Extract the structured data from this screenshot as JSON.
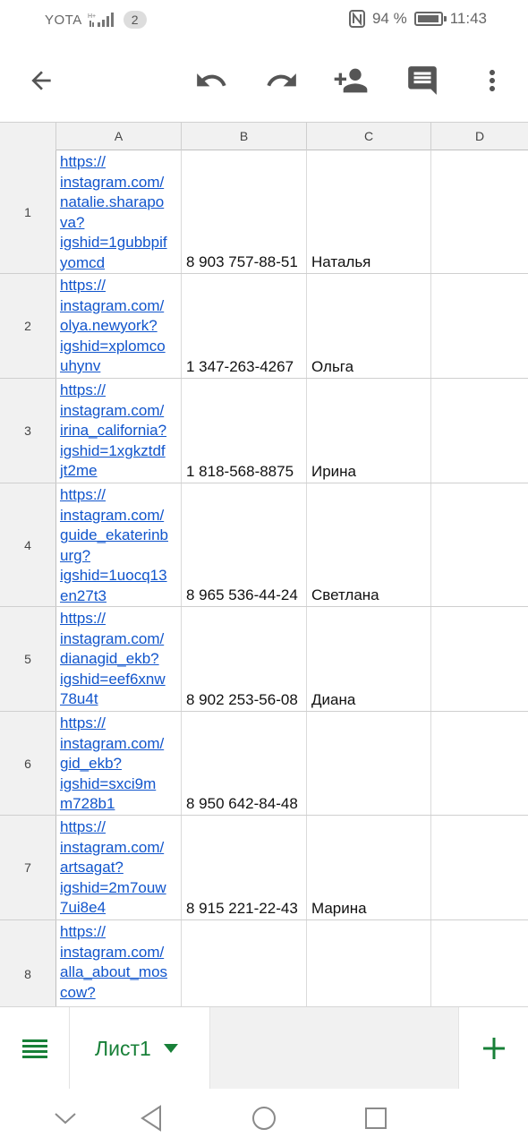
{
  "status_bar": {
    "carrier": "YOTA",
    "notifications_count": "2",
    "battery_text": "94 %",
    "battery_level": 0.94,
    "time": "11:43"
  },
  "toolbar": {
    "icons": [
      "back-arrow-icon",
      "undo-icon",
      "redo-icon",
      "add-person-icon",
      "comment-icon",
      "more-vert-icon"
    ]
  },
  "grid": {
    "columns": [
      "A",
      "B",
      "C",
      "D"
    ],
    "rows": [
      {
        "num": "1",
        "a_lines": [
          "https://",
          "instagram.com/",
          "natalie.sharapo",
          "va?",
          "igshid=1gubbpif",
          "yomcd"
        ],
        "b": "8 903 757-88-51",
        "c": "Наталья"
      },
      {
        "num": "2",
        "a_lines": [
          "https://",
          "instagram.com/",
          "olya.newyork?",
          "igshid=xplomco",
          "uhynv"
        ],
        "b": "1 347-263-4267",
        "c": "Ольга"
      },
      {
        "num": "3",
        "a_lines": [
          "https://",
          "instagram.com/",
          "irina_california?",
          "igshid=1xgkztdf",
          "jt2me"
        ],
        "b": "1 818-568-8875",
        "c": "Ирина"
      },
      {
        "num": "4",
        "a_lines": [
          "https://",
          "instagram.com/",
          "guide_ekaterinb",
          "urg?",
          "igshid=1uocq13",
          "en27t3"
        ],
        "b": "8 965 536-44-24",
        "c": "Светлана"
      },
      {
        "num": "5",
        "a_lines": [
          "https://",
          "instagram.com/",
          "dianagid_ekb?",
          "igshid=eef6xnw",
          "78u4t"
        ],
        "b": "8 902 253-56-08",
        "c": "Диана"
      },
      {
        "num": "6",
        "a_lines": [
          "https://",
          "instagram.com/",
          "gid_ekb?",
          "igshid=sxci9m",
          "m728b1"
        ],
        "b": "8 950 642-84-48",
        "c": ""
      },
      {
        "num": "7",
        "a_lines": [
          "https://",
          "instagram.com/",
          "artsagat?",
          "igshid=2m7ouw",
          "7ui8e4"
        ],
        "b": "8 915 221-22-43",
        "c": "Марина"
      },
      {
        "num": "8",
        "a_lines": [
          "https://",
          "instagram.com/",
          "alla_about_mos",
          "cow?"
        ],
        "b": "",
        "c": ""
      }
    ]
  },
  "sheets": {
    "active_tab": "Лист1"
  },
  "colors": {
    "link": "#1155cc",
    "accent_green": "#188038",
    "header_bg": "#f1f1f1"
  }
}
